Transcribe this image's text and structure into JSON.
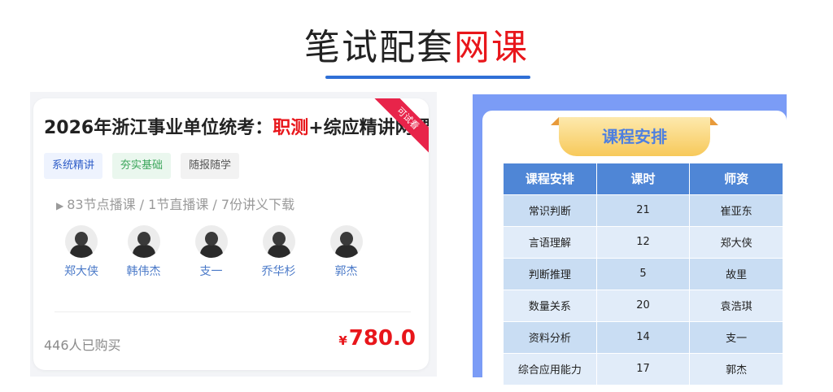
{
  "header": {
    "title_part1": "笔试配套",
    "title_part2": "网课",
    "accent_color": "#e8161b",
    "underline_color": "#2f6fd6"
  },
  "course": {
    "title_prefix": "2026年浙江事业单位统考：",
    "title_highlight": "职测",
    "title_suffix": "+综应精讲网课",
    "ribbon": "可试看",
    "tags": [
      "系统精讲",
      "夯实基础",
      "随报随学"
    ],
    "lessons": "83节点播课 / 1节直播课 / 7份讲义下载",
    "teachers": [
      {
        "name": "郑大侠"
      },
      {
        "name": "韩伟杰"
      },
      {
        "name": "支一"
      },
      {
        "name": "乔华杉"
      },
      {
        "name": "郭杰"
      }
    ],
    "buyers": "446人已购买",
    "price_symbol": "¥",
    "price": "780.0"
  },
  "schedule": {
    "banner": "课程安排",
    "headers": [
      "课程安排",
      "课时",
      "师资"
    ],
    "rows": [
      [
        "常识判断",
        "21",
        "崔亚东"
      ],
      [
        "言语理解",
        "12",
        "郑大侠"
      ],
      [
        "判断推理",
        "5",
        "故里"
      ],
      [
        "数量关系",
        "20",
        "袁浩琪"
      ],
      [
        "资料分析",
        "14",
        "支一"
      ],
      [
        "综合应用能力",
        "17",
        "郭杰"
      ]
    ]
  }
}
